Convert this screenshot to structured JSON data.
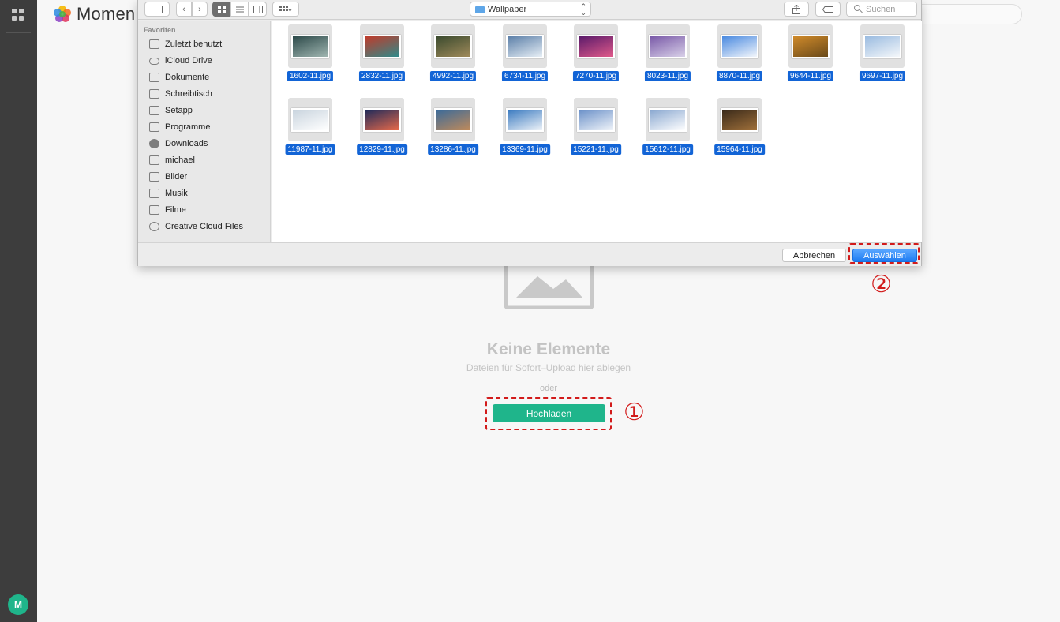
{
  "app": {
    "title": "Momen",
    "avatar_initial": "M"
  },
  "empty_state": {
    "title": "Keine Elemente",
    "subtitle": "Dateien für Sofort–Upload hier ablegen",
    "or": "oder",
    "upload_label": "Hochladen"
  },
  "annotations": {
    "step1": "①",
    "step2": "②"
  },
  "dialog": {
    "location": "Wallpaper",
    "search_placeholder": "Suchen",
    "sidebar_header": "Favoriten",
    "sidebar_items": [
      {
        "label": "Zuletzt benutzt",
        "icon": "clock-icon"
      },
      {
        "label": "iCloud Drive",
        "icon": "cloud-icon"
      },
      {
        "label": "Dokumente",
        "icon": "document-icon"
      },
      {
        "label": "Schreibtisch",
        "icon": "desktop-icon"
      },
      {
        "label": "Setapp",
        "icon": "folder-icon"
      },
      {
        "label": "Programme",
        "icon": "apps-icon"
      },
      {
        "label": "Downloads",
        "icon": "download-icon"
      },
      {
        "label": "michael",
        "icon": "home-icon"
      },
      {
        "label": "Bilder",
        "icon": "camera-icon"
      },
      {
        "label": "Musik",
        "icon": "music-icon"
      },
      {
        "label": "Filme",
        "icon": "film-icon"
      },
      {
        "label": "Creative Cloud Files",
        "icon": "creative-cloud-icon"
      }
    ],
    "files": [
      {
        "name": "1602-11.jpg",
        "colors": [
          "#2d4a4a",
          "#9fb5b0"
        ]
      },
      {
        "name": "2832-11.jpg",
        "colors": [
          "#c23a2a",
          "#2f8a8a"
        ]
      },
      {
        "name": "4992-11.jpg",
        "colors": [
          "#3a4a2e",
          "#a08a5a"
        ]
      },
      {
        "name": "6734-11.jpg",
        "colors": [
          "#5b7fa8",
          "#e6eef5"
        ]
      },
      {
        "name": "7270-11.jpg",
        "colors": [
          "#5a1a6a",
          "#e05a8a"
        ]
      },
      {
        "name": "8023-11.jpg",
        "colors": [
          "#7a5aa8",
          "#d8d0e8"
        ]
      },
      {
        "name": "8870-11.jpg",
        "colors": [
          "#4a8ae0",
          "#f2f6fb"
        ]
      },
      {
        "name": "9644-11.jpg",
        "colors": [
          "#d08a2a",
          "#6a4a1a"
        ]
      },
      {
        "name": "9697-11.jpg",
        "colors": [
          "#9abbe0",
          "#f4f7fa"
        ]
      },
      {
        "name": "11987-11.jpg",
        "colors": [
          "#c9d4de",
          "#ffffff"
        ]
      },
      {
        "name": "12829-11.jpg",
        "colors": [
          "#1e2a5a",
          "#e86a4a"
        ]
      },
      {
        "name": "13286-11.jpg",
        "colors": [
          "#3a6a9a",
          "#c08a5a"
        ]
      },
      {
        "name": "13369-11.jpg",
        "colors": [
          "#3a7ac0",
          "#eef3f8"
        ]
      },
      {
        "name": "15221-11.jpg",
        "colors": [
          "#6a90c8",
          "#f0f4f9"
        ]
      },
      {
        "name": "15612-11.jpg",
        "colors": [
          "#8aa8d0",
          "#ffffff"
        ]
      },
      {
        "name": "15964-11.jpg",
        "colors": [
          "#3a2a1a",
          "#a0703a"
        ]
      }
    ],
    "cancel_label": "Abbrechen",
    "select_label": "Auswählen"
  },
  "colors": {
    "accent": "#1fb58b",
    "selection": "#1264d6",
    "annotation": "#d21b1b"
  }
}
